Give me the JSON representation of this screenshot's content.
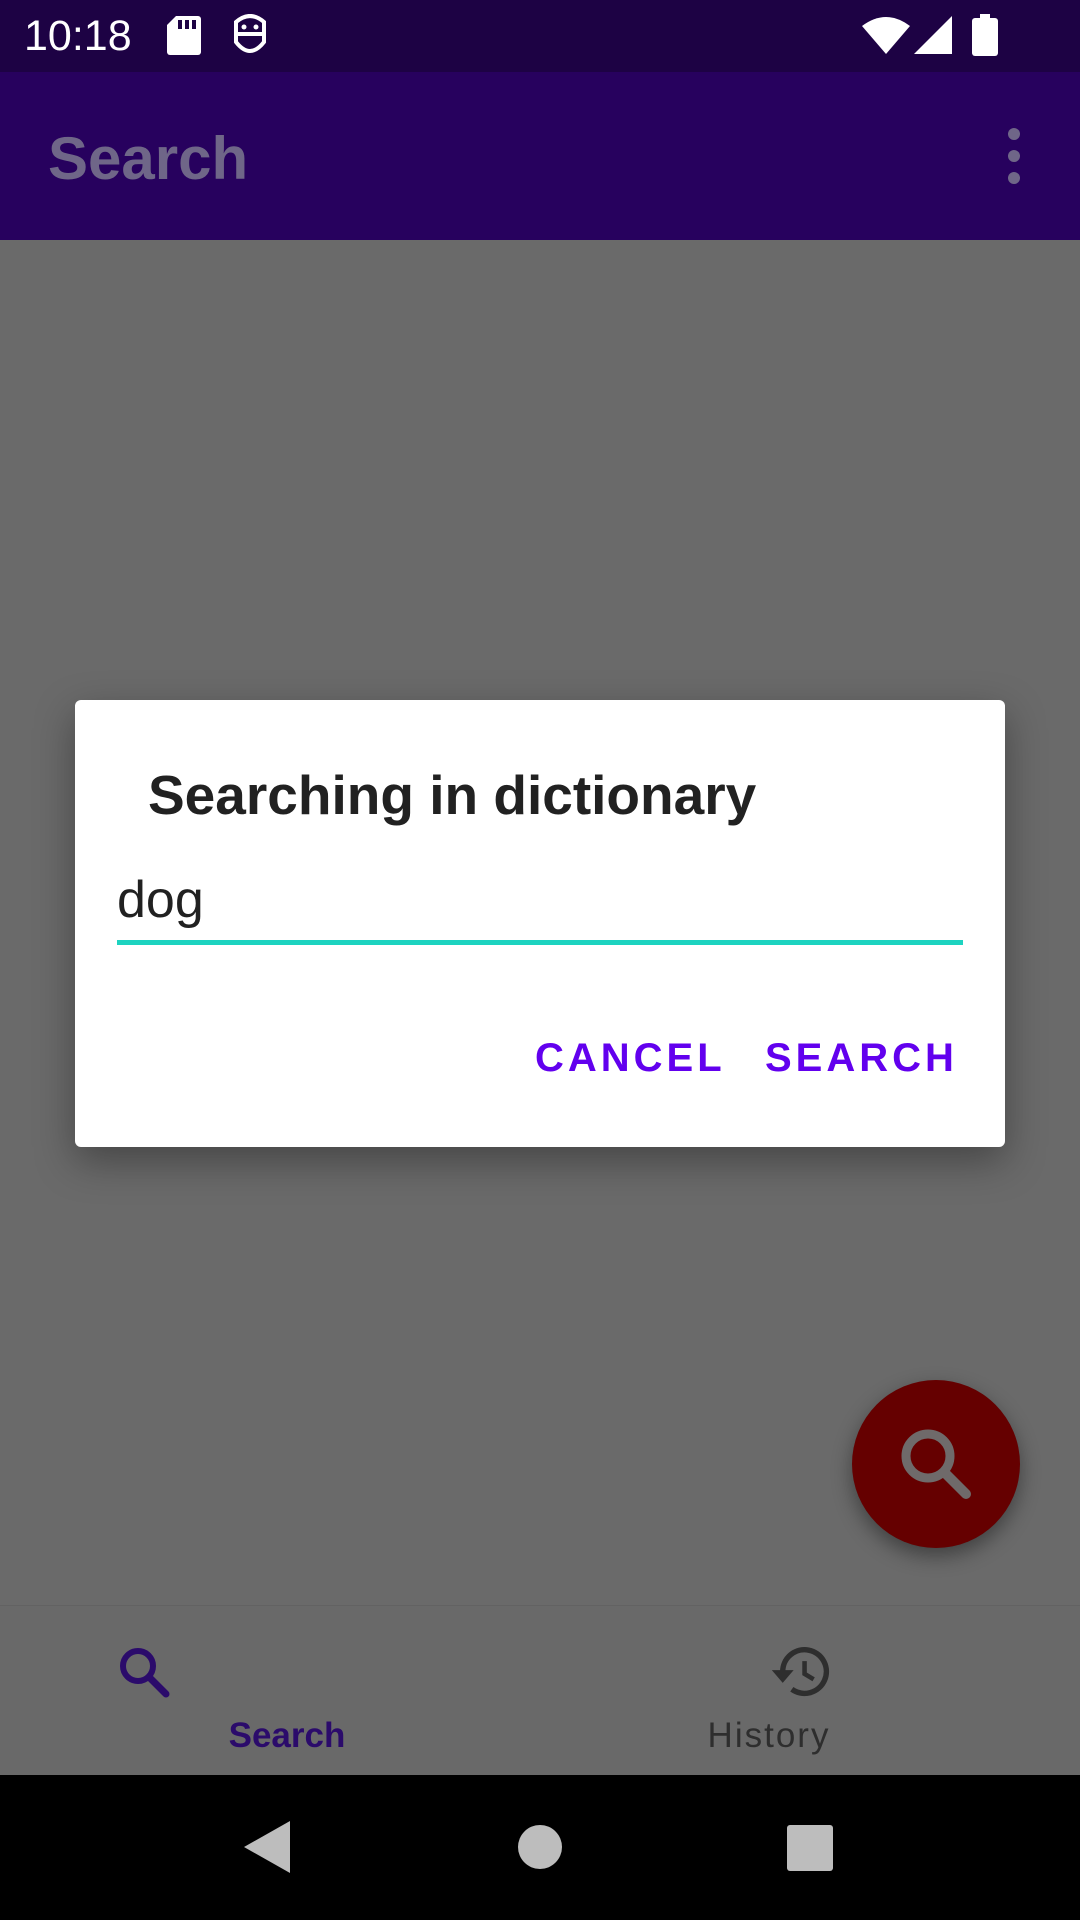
{
  "status_bar": {
    "time": "10:18",
    "icons": [
      "sd-card-icon",
      "android-debug-icon",
      "wifi-icon",
      "signal-icon",
      "battery-icon"
    ]
  },
  "app_bar": {
    "title": "Search",
    "overflow_icon": "more-vert-icon"
  },
  "dialog": {
    "title": "Searching in dictionary",
    "input_value": "dog",
    "cancel_label": "CANCEL",
    "search_label": "SEARCH"
  },
  "fab": {
    "icon": "search-icon",
    "color": "#650000"
  },
  "bottom_nav": {
    "items": [
      {
        "label": "Search",
        "icon": "search-icon",
        "selected": true
      },
      {
        "label": "History",
        "icon": "history-icon",
        "selected": false
      }
    ]
  },
  "system_nav": {
    "icons": [
      "back-icon",
      "home-icon",
      "recents-icon"
    ]
  },
  "colors": {
    "status_bar": "#1d0244",
    "app_bar": "#27015e",
    "accent": "#6200ee",
    "input_underline": "#1dd3c0",
    "scrim": "#6a6a6a"
  }
}
